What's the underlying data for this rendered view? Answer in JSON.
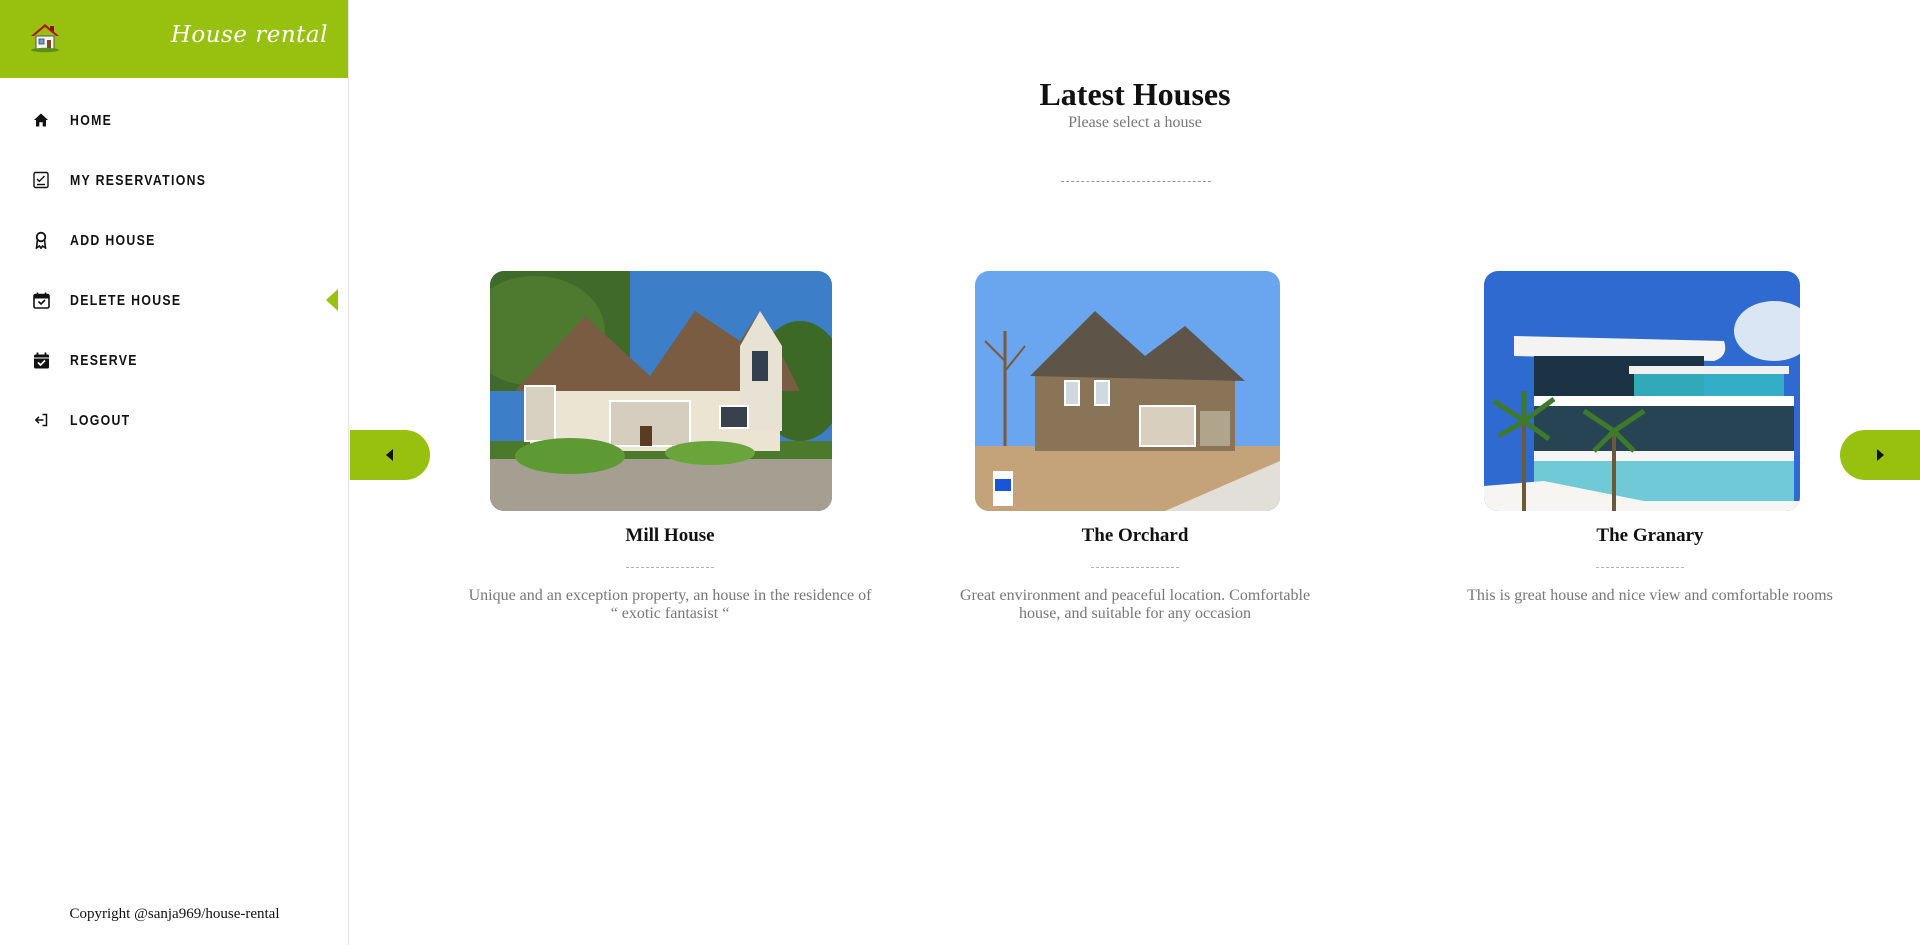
{
  "brand": {
    "name": "House rental",
    "logo_icon": "house-logo-icon",
    "accent_color": "#97c10e"
  },
  "sidebar": {
    "items": [
      {
        "label": "HOME",
        "icon": "home-icon"
      },
      {
        "label": "MY RESERVATIONS",
        "icon": "checklist-icon"
      },
      {
        "label": "ADD HOUSE",
        "icon": "add-house-icon"
      },
      {
        "label": "DELETE HOUSE",
        "icon": "calendar-delete-icon",
        "active": true
      },
      {
        "label": "RESERVE",
        "icon": "calendar-check-icon"
      },
      {
        "label": "LOGOUT",
        "icon": "logout-icon"
      }
    ],
    "copyright": "Copyright @sanja969/house-rental"
  },
  "main": {
    "title": "Latest Houses",
    "subtitle": "Please select a house",
    "houses": [
      {
        "name": "Mill House",
        "description": "Unique and an exception property, an house in the residence of “ exotic fantasist “"
      },
      {
        "name": "The Orchard",
        "description": "Great environment and peaceful location. Comfortable house, and suitable for any occasion"
      },
      {
        "name": "The Granary",
        "description": "This is great house and nice view and comfortable rooms"
      }
    ]
  }
}
